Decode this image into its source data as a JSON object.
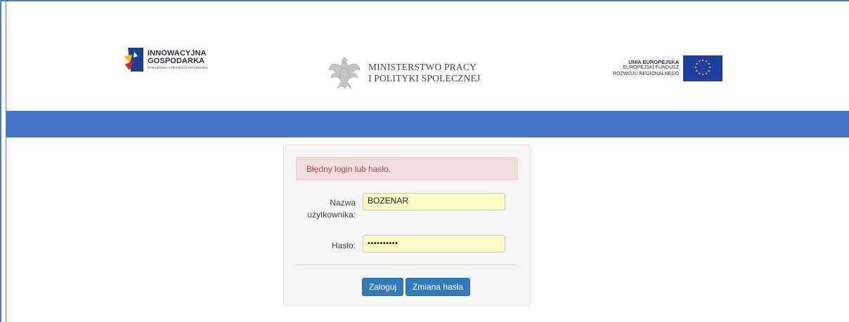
{
  "header": {
    "logo_left": {
      "line1": "INNOWACYJNA",
      "line2": "GOSPODARKA",
      "line3": "NARODOWA STRATEGIA SPÓJNOŚCI"
    },
    "logo_center": {
      "line1": "MINISTERSTWO PRACY",
      "line2": "I POLITYKI SPOŁECZNEJ"
    },
    "logo_right": {
      "line1": "UNIA EUROPEJSKA",
      "line2": "EUROPEJSKI FUNDUSZ",
      "line3": "ROZWOJU REGIONALNEGO"
    }
  },
  "colors": {
    "bar": "#4575c9",
    "alert_bg": "#f2dede",
    "alert_text": "#a94442",
    "button": "#337ab7",
    "input_bg": "#fcfdc4"
  },
  "login": {
    "error_message": "Błędny login lub hasło.",
    "username_label": "Nazwa użytkownika:",
    "username_value": "BOZENAR",
    "password_label": "Hasło:",
    "password_value": "••••••••••",
    "login_button": "Zaloguj",
    "change_password_button": "Zmiana hasła"
  }
}
